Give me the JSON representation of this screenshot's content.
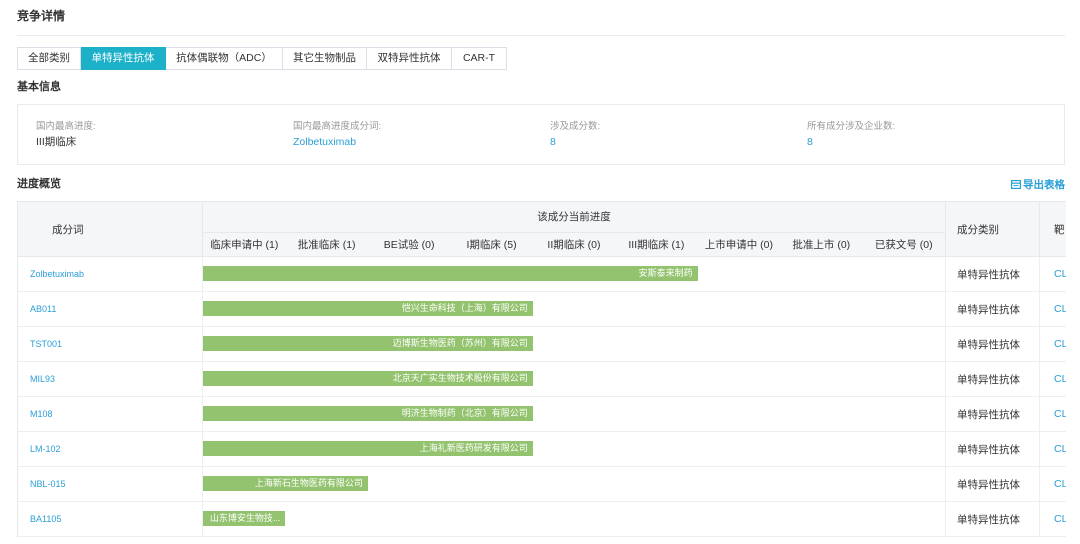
{
  "page": {
    "title": "竞争详情"
  },
  "tabs": [
    {
      "label": "全部类别",
      "active": false
    },
    {
      "label": "单特异性抗体",
      "active": true
    },
    {
      "label": "抗体偶联物（ADC）",
      "active": false
    },
    {
      "label": "其它生物制品",
      "active": false
    },
    {
      "label": "双特异性抗体",
      "active": false
    },
    {
      "label": "CAR-T",
      "active": false
    }
  ],
  "basic_info": {
    "title": "基本信息",
    "fields": [
      {
        "label": "国内最高进度:",
        "value": "III期临床"
      },
      {
        "label": "国内最高进度成分词:",
        "value": "Zolbetuximab"
      },
      {
        "label": "涉及成分数:",
        "value": "8"
      },
      {
        "label": "所有成分涉及企业数:",
        "value": "8"
      }
    ]
  },
  "progress_overview": {
    "title": "进度概览",
    "export_label": "导出表格",
    "export_icon": "export-table-icon"
  },
  "table": {
    "headers": {
      "ingredient": "成分词",
      "progress_group": "该成分当前进度",
      "stages": [
        "临床申请中 (1)",
        "批准临床 (1)",
        "BE试验 (0)",
        "I期临床 (5)",
        "II期临床 (0)",
        "III期临床 (1)",
        "上市申请中 (0)",
        "批准上市 (0)",
        "已获文号 (0)"
      ],
      "category": "成分类别",
      "target": "靶"
    },
    "rows": [
      {
        "ingredient": "Zolbetuximab",
        "progress_stage": 6,
        "company": "安斯泰来制药",
        "category": "单特异性抗体",
        "target": "CL"
      },
      {
        "ingredient": "AB011",
        "progress_stage": 4,
        "company": "恺兴生命科技（上海）有限公司",
        "category": "单特异性抗体",
        "target": "CL"
      },
      {
        "ingredient": "TST001",
        "progress_stage": 4,
        "company": "迈博斯生物医药（苏州）有限公司",
        "category": "单特异性抗体",
        "target": "CL"
      },
      {
        "ingredient": "MIL93",
        "progress_stage": 4,
        "company": "北京天广实生物技术股份有限公司",
        "category": "单特异性抗体",
        "target": "CL"
      },
      {
        "ingredient": "M108",
        "progress_stage": 4,
        "company": "明济生物制药（北京）有限公司",
        "category": "单特异性抗体",
        "target": "CL"
      },
      {
        "ingredient": "LM-102",
        "progress_stage": 4,
        "company": "上海礼新医药研发有限公司",
        "category": "单特异性抗体",
        "target": "CL"
      },
      {
        "ingredient": "NBL-015",
        "progress_stage": 2,
        "company": "上海新石生物医药有限公司",
        "category": "单特异性抗体",
        "target": "CL"
      },
      {
        "ingredient": "BA1105",
        "progress_stage": 1,
        "company": "山东博安生物技...",
        "category": "单特异性抗体",
        "target": "CL"
      }
    ]
  },
  "colors": {
    "accent": "#1cb0c9",
    "link": "#2a9fd6",
    "bar": "#93c36e"
  }
}
